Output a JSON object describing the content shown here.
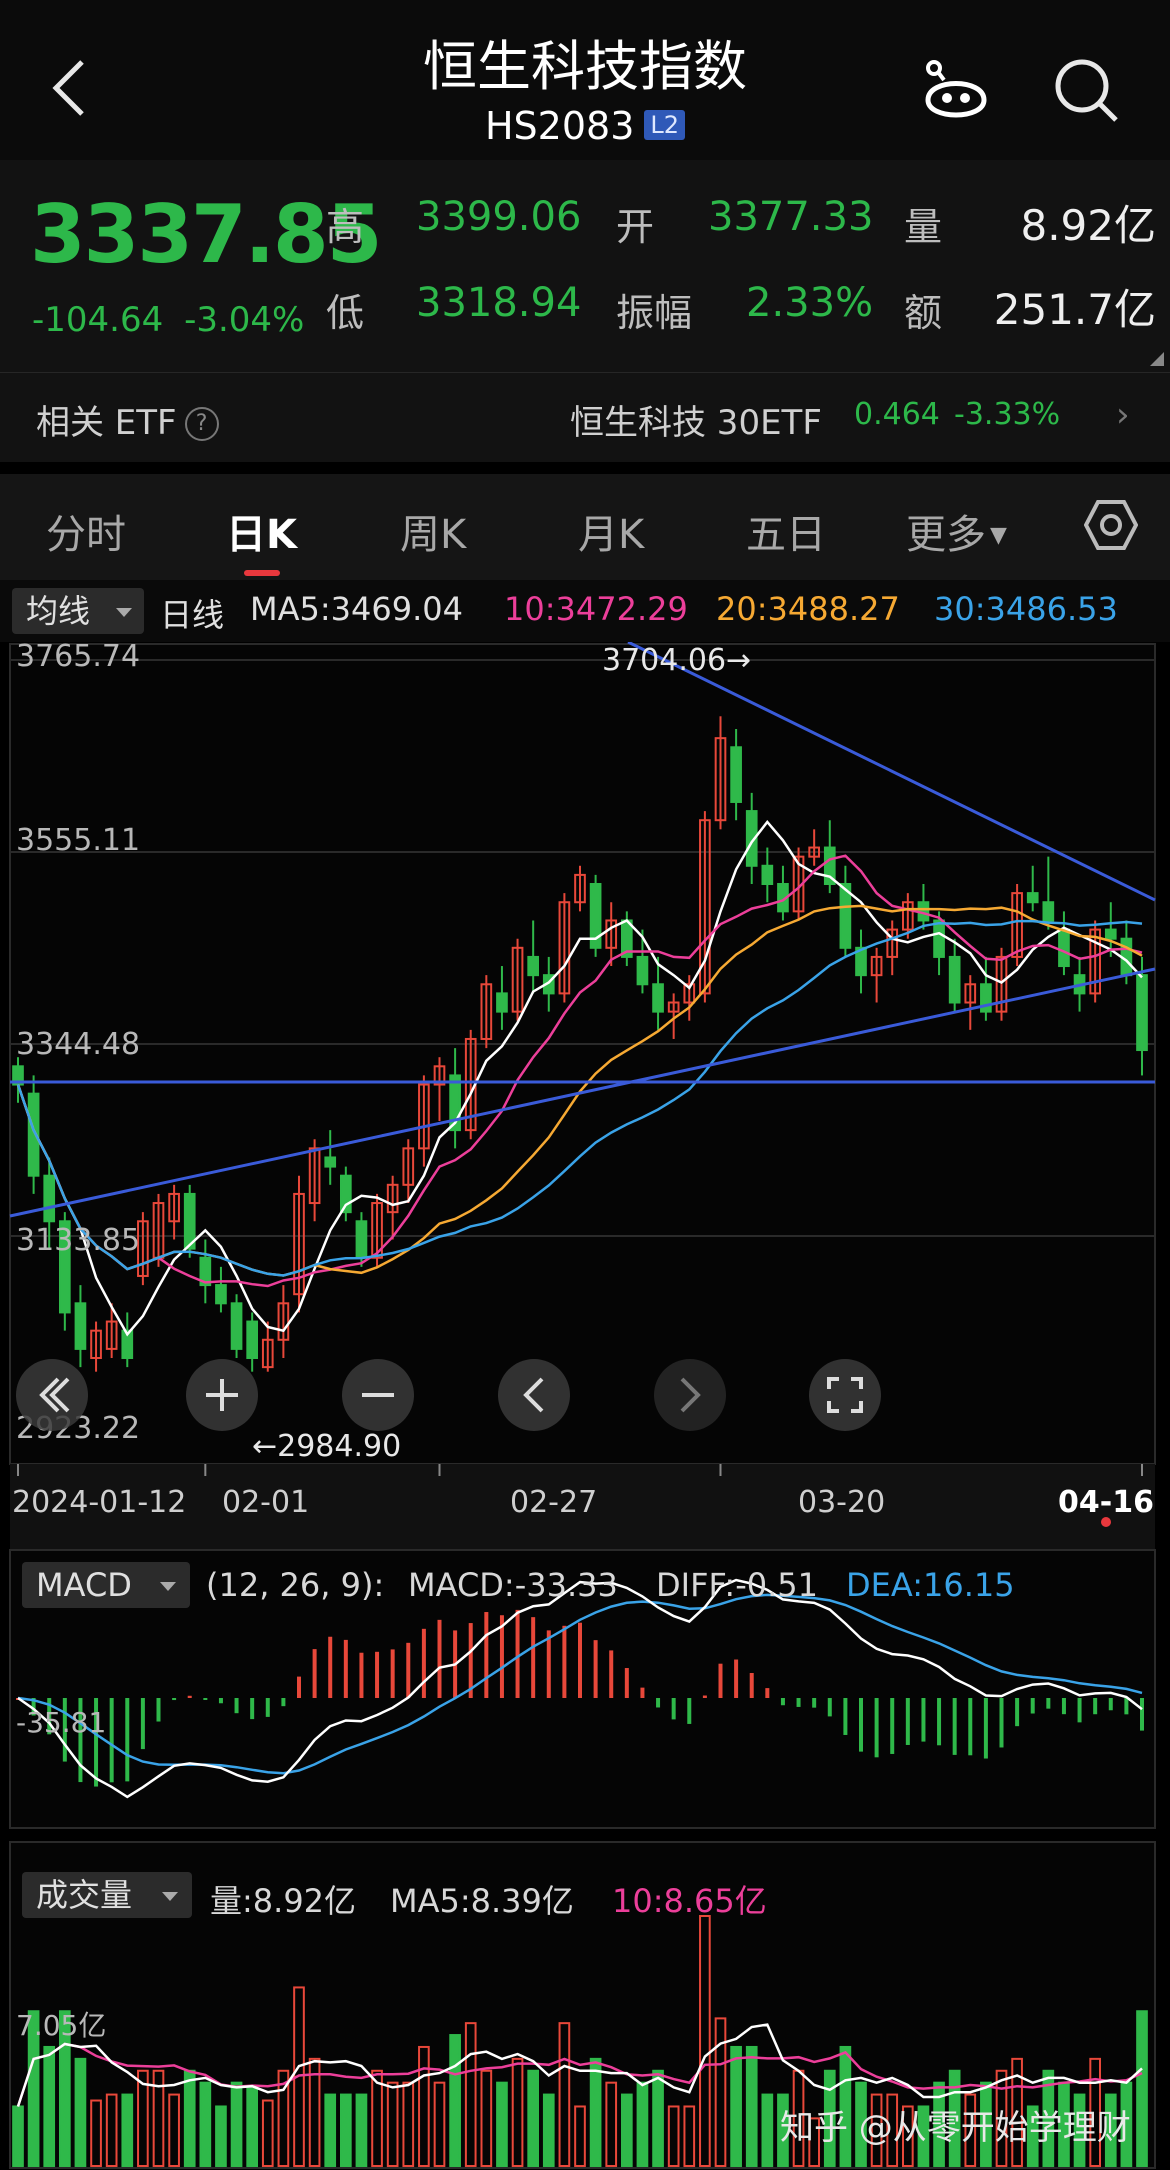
{
  "header": {
    "title": "恒生科技指数",
    "code": "HS2083",
    "badge": "L2"
  },
  "quote": {
    "price": "3337.85",
    "change": "-104.64",
    "change_pct": "-3.04%",
    "high_label": "高",
    "high": "3399.06",
    "open_label": "开",
    "open": "3377.33",
    "volume_label": "量",
    "volume": "8.92亿",
    "low_label": "低",
    "low": "3318.94",
    "amplitude_label": "振幅",
    "amplitude": "2.33%",
    "turnover_label": "额",
    "turnover": "251.7亿"
  },
  "etf": {
    "label": "相关 ETF",
    "help": "?",
    "name": "恒生科技 30ETF",
    "price": "0.464",
    "change": "-3.33%"
  },
  "tabs": [
    "分时",
    "日K",
    "周K",
    "月K",
    "五日",
    "更多"
  ],
  "active_tab": "日K",
  "ma_bar": {
    "selector": "均线",
    "period": "日线",
    "ma5": "MA5:3469.04",
    "ma10": "10:3472.29",
    "ma20": "20:3488.27",
    "ma30": "30:3486.53"
  },
  "kline": {
    "y_labels": [
      "3765.74",
      "3555.11",
      "3344.48",
      "3133.85",
      "2923.22"
    ],
    "max_label": "3704.06→",
    "min_label": "←2984.90",
    "x_labels": [
      "2024-01-12",
      "02-01",
      "02-27",
      "03-20",
      "04-16"
    ]
  },
  "macd": {
    "selector": "MACD",
    "params": "(12, 26, 9):",
    "macd": "MACD:-33.33",
    "diff": "DIFF:-0.51",
    "dea": "DEA:16.15",
    "y_label": "-35.81"
  },
  "volume": {
    "selector": "成交量",
    "vol": "量:8.92亿",
    "ma5": "MA5:8.39亿",
    "ma10": "10:8.65亿",
    "y_label": "7.05亿"
  },
  "watermark": "知乎 @从零开始学理财",
  "colors": {
    "up": "#e8483a",
    "down": "#2fb94a",
    "ma5": "#ffffff",
    "ma10": "#ec3f9a",
    "ma20": "#f6a933",
    "ma30": "#3aa3e8",
    "trendline": "#3a5bd9"
  },
  "chart_data": {
    "type": "candlestick",
    "ohlc": [
      [
        3320,
        3330,
        3280,
        3300
      ],
      [
        3290,
        3310,
        3180,
        3200
      ],
      [
        3200,
        3220,
        3120,
        3150
      ],
      [
        3150,
        3160,
        3030,
        3050
      ],
      [
        3060,
        3080,
        2990,
        3010
      ],
      [
        3000,
        3040,
        2985,
        3030
      ],
      [
        3010,
        3060,
        3000,
        3040
      ],
      [
        3030,
        3050,
        2990,
        3000
      ],
      [
        3090,
        3160,
        3080,
        3150
      ],
      [
        3110,
        3180,
        3100,
        3170
      ],
      [
        3150,
        3190,
        3130,
        3180
      ],
      [
        3180,
        3190,
        3110,
        3120
      ],
      [
        3110,
        3130,
        3060,
        3080
      ],
      [
        3080,
        3100,
        3050,
        3060
      ],
      [
        3060,
        3070,
        3000,
        3010
      ],
      [
        3040,
        3050,
        2985,
        3000
      ],
      [
        2990,
        3040,
        2985,
        3020
      ],
      [
        3020,
        3080,
        3000,
        3060
      ],
      [
        3070,
        3200,
        3050,
        3180
      ],
      [
        3170,
        3240,
        3150,
        3230
      ],
      [
        3220,
        3250,
        3190,
        3210
      ],
      [
        3200,
        3210,
        3150,
        3160
      ],
      [
        3150,
        3160,
        3100,
        3110
      ],
      [
        3110,
        3180,
        3100,
        3170
      ],
      [
        3160,
        3200,
        3130,
        3190
      ],
      [
        3190,
        3240,
        3170,
        3230
      ],
      [
        3230,
        3310,
        3210,
        3300
      ],
      [
        3300,
        3330,
        3260,
        3320
      ],
      [
        3310,
        3340,
        3230,
        3250
      ],
      [
        3250,
        3360,
        3240,
        3350
      ],
      [
        3350,
        3420,
        3340,
        3410
      ],
      [
        3400,
        3430,
        3360,
        3380
      ],
      [
        3380,
        3460,
        3370,
        3450
      ],
      [
        3440,
        3480,
        3400,
        3420
      ],
      [
        3420,
        3440,
        3380,
        3400
      ],
      [
        3400,
        3510,
        3390,
        3500
      ],
      [
        3500,
        3540,
        3490,
        3530
      ],
      [
        3520,
        3530,
        3440,
        3450
      ],
      [
        3450,
        3500,
        3430,
        3480
      ],
      [
        3480,
        3490,
        3430,
        3440
      ],
      [
        3440,
        3470,
        3400,
        3410
      ],
      [
        3410,
        3440,
        3360,
        3380
      ],
      [
        3380,
        3400,
        3350,
        3390
      ],
      [
        3390,
        3420,
        3370,
        3410
      ],
      [
        3400,
        3600,
        3390,
        3590
      ],
      [
        3590,
        3704,
        3580,
        3680
      ],
      [
        3670,
        3690,
        3590,
        3610
      ],
      [
        3600,
        3620,
        3520,
        3540
      ],
      [
        3540,
        3560,
        3500,
        3520
      ],
      [
        3520,
        3540,
        3480,
        3490
      ],
      [
        3490,
        3560,
        3480,
        3550
      ],
      [
        3550,
        3580,
        3540,
        3560
      ],
      [
        3560,
        3590,
        3510,
        3520
      ],
      [
        3520,
        3540,
        3440,
        3450
      ],
      [
        3450,
        3470,
        3400,
        3420
      ],
      [
        3420,
        3450,
        3390,
        3440
      ],
      [
        3440,
        3480,
        3420,
        3470
      ],
      [
        3470,
        3510,
        3460,
        3500
      ],
      [
        3500,
        3520,
        3470,
        3480
      ],
      [
        3480,
        3490,
        3420,
        3440
      ],
      [
        3440,
        3460,
        3380,
        3390
      ],
      [
        3390,
        3420,
        3360,
        3410
      ],
      [
        3410,
        3440,
        3370,
        3380
      ],
      [
        3380,
        3450,
        3370,
        3440
      ],
      [
        3440,
        3520,
        3430,
        3510
      ],
      [
        3510,
        3540,
        3490,
        3500
      ],
      [
        3500,
        3550,
        3470,
        3480
      ],
      [
        3470,
        3490,
        3420,
        3430
      ],
      [
        3420,
        3440,
        3380,
        3400
      ],
      [
        3400,
        3480,
        3390,
        3470
      ],
      [
        3470,
        3500,
        3440,
        3460
      ],
      [
        3460,
        3480,
        3410,
        3420
      ],
      [
        3420,
        3440,
        3310,
        3337.85
      ]
    ]
  }
}
